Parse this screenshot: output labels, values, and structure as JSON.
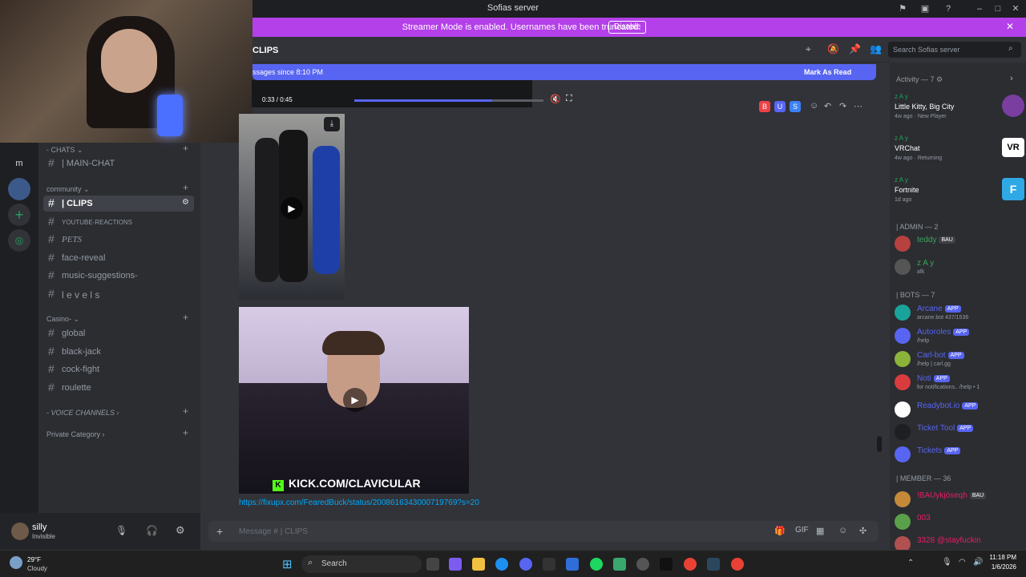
{
  "window": {
    "title": "Sofias server"
  },
  "banner": {
    "text": "Streamer Mode is enabled. Usernames have been truncated.",
    "button": "Disable"
  },
  "channel_header": {
    "name": "CLIPS",
    "search_placeholder": "Search Sofias server"
  },
  "new_messages": {
    "text": "ssages since 8:10 PM",
    "action": "Mark As Read"
  },
  "video_top": {
    "time": "0:33 / 0:45"
  },
  "reaction_buttons": [
    "B",
    "U",
    "S"
  ],
  "sidebar": {
    "categories": [
      {
        "name": "- CHATS",
        "channels": [
          {
            "name": "| MAIN-CHAT",
            "active": false
          }
        ]
      },
      {
        "name": "community",
        "channels": [
          {
            "name": "| CLIPS",
            "active": true
          },
          {
            "name": "YOUTUBE-REACTIONS",
            "active": false
          },
          {
            "name": "PETS",
            "active": false
          },
          {
            "name": "face-reveal",
            "active": false
          },
          {
            "name": "music-suggestions-",
            "active": false
          },
          {
            "name": "l e v e l s",
            "active": false
          }
        ]
      },
      {
        "name": "Casino-",
        "channels": [
          {
            "name": "global",
            "active": false
          },
          {
            "name": "black-jack",
            "active": false
          },
          {
            "name": "cock-fight",
            "active": false
          },
          {
            "name": "roulette",
            "active": false
          }
        ]
      },
      {
        "name": "- VOICE CHANNELS",
        "channels": []
      },
      {
        "name": "Private Category",
        "channels": []
      }
    ]
  },
  "user": {
    "name": "silly",
    "status": "Invisible"
  },
  "message": {
    "link": "https://fixupx.com/FearedBuck/status/2008616343000719769?s=20",
    "video_caption": "KICK.COM/CLAVICULAR"
  },
  "composer": {
    "placeholder": "Message #",
    "channel": "| CLIPS"
  },
  "members": {
    "activity_title": "Activity — 7",
    "activities": [
      {
        "user": "z A y",
        "game": "Little Kitty, Big City",
        "ago": "4w ago",
        "tag": "New Player"
      },
      {
        "user": "z A y",
        "game": "VRChat",
        "ago": "4w ago",
        "tag": "Returning"
      },
      {
        "user": "z A y",
        "game": "Fortnite",
        "ago": "1d ago",
        "tag": ""
      }
    ],
    "sections": [
      {
        "title": "| ADMIN — 2",
        "items": [
          {
            "name": "teddy",
            "sub": "",
            "badge": "BAU",
            "color": "#3ba55c"
          },
          {
            "name": "z A y",
            "sub": "afk",
            "badge": "",
            "color": "#3ba55c"
          }
        ]
      },
      {
        "title": "| BOTS — 7",
        "items": [
          {
            "name": "Arcane",
            "sub": "arcane.bot 437/1536",
            "badge": "APP",
            "color": "#5865f2"
          },
          {
            "name": "Autoroles",
            "sub": "/help",
            "badge": "APP",
            "color": "#5865f2"
          },
          {
            "name": "Carl-bot",
            "sub": "/help | carl.gg",
            "badge": "APP",
            "color": "#5865f2"
          },
          {
            "name": "Noti",
            "sub": "for notifications.. /help • 1",
            "badge": "APP",
            "color": "#5865f2"
          },
          {
            "name": "Readybot.io",
            "sub": "",
            "badge": "APP",
            "color": "#5865f2"
          },
          {
            "name": "Ticket Tool",
            "sub": "",
            "badge": "APP",
            "color": "#5865f2"
          },
          {
            "name": "Tickets",
            "sub": "",
            "badge": "APP",
            "color": "#5865f2"
          }
        ]
      },
      {
        "title": "| MEMBER — 36",
        "items": [
          {
            "name": "!BAUykjóseqh",
            "sub": "",
            "badge": "BAU",
            "color": "#e91e63"
          },
          {
            "name": "003",
            "sub": "",
            "badge": "",
            "color": "#e91e63"
          },
          {
            "name": "3328 @stayfuckin",
            "sub": "",
            "badge": "",
            "color": "#e91e63"
          }
        ]
      }
    ]
  },
  "taskbar": {
    "weather_temp": "29°F",
    "weather_text": "Cloudy",
    "search": "Search",
    "time": "11:18 PM",
    "date": "1/6/2026"
  }
}
